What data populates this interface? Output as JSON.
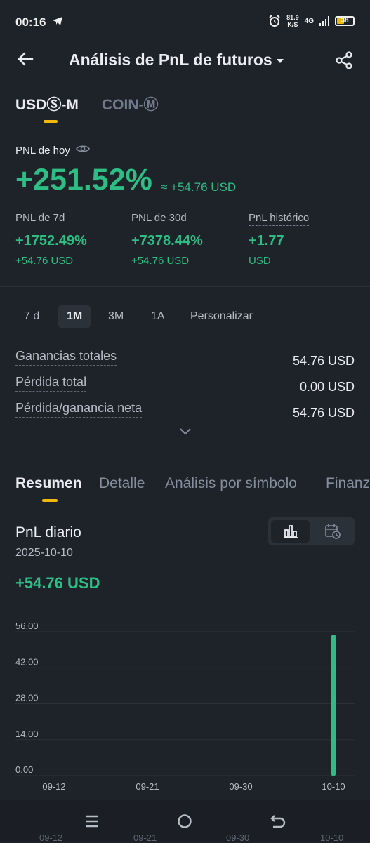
{
  "status_bar": {
    "time": "00:16",
    "network_speed_value": "81.9",
    "network_speed_unit": "K/S",
    "network": "4G",
    "battery": "38",
    "icons": [
      "telegram-icon",
      "alarm-icon",
      "signal-icon",
      "battery-icon"
    ]
  },
  "header": {
    "title": "Análisis de PnL de futuros",
    "back_icon": "arrow-left-icon",
    "share_icon": "share-icon"
  },
  "market_tabs": [
    {
      "label": "USDⓈ-M",
      "active": true
    },
    {
      "label": "COIN-Ⓜ",
      "active": false
    }
  ],
  "today": {
    "label": "PNL de hoy",
    "percent": "+251.52%",
    "approx": "≈ +54.76 USD"
  },
  "stats": [
    {
      "label": "PNL de 7d",
      "value": "+1752.49%",
      "sub": "+54.76 USD"
    },
    {
      "label": "PNL de 30d",
      "value": "+7378.44%",
      "sub": "+54.76 USD"
    },
    {
      "label": "PnL histórico",
      "value": "+1.77",
      "sub": "USD"
    }
  ],
  "periods": [
    {
      "label": "7 d",
      "active": false
    },
    {
      "label": "1M",
      "active": true
    },
    {
      "label": "3M",
      "active": false
    },
    {
      "label": "1A",
      "active": false
    },
    {
      "label": "Personalizar",
      "active": false
    }
  ],
  "summary": [
    {
      "label": "Ganancias totales",
      "value": "54.76 USD"
    },
    {
      "label": "Pérdida total",
      "value": "0.00 USD"
    },
    {
      "label": "Pérdida/ganancia neta",
      "value": "54.76 USD"
    }
  ],
  "section_tabs": [
    {
      "label": "Resumen",
      "active": true
    },
    {
      "label": "Detalle",
      "active": false
    },
    {
      "label": "Análisis por símbolo",
      "active": false
    },
    {
      "label": "Finanz",
      "active": false
    }
  ],
  "daily": {
    "title": "PnL diario",
    "date": "2025-10-10",
    "value": "+54.76 USD"
  },
  "colors": {
    "background": "#1e2329",
    "positive": "#2ebd85",
    "accent": "#f0b90b",
    "muted": "#848e9c"
  },
  "chart_data": {
    "type": "bar",
    "x_labels": [
      "09-12",
      "09-21",
      "09-30",
      "10-10"
    ],
    "y_ticks": [
      "0.00",
      "14.00",
      "28.00",
      "42.00",
      "56.00"
    ],
    "ylim": [
      0,
      56
    ],
    "categories": [
      "10-10"
    ],
    "values": [
      54.76
    ],
    "grid": true
  },
  "nav_bar": {
    "icons": [
      "menu-icon",
      "home-circle-icon",
      "back-icon"
    ],
    "ghost_labels": [
      "09-12",
      "09-21",
      "09-30",
      "10-10"
    ]
  }
}
